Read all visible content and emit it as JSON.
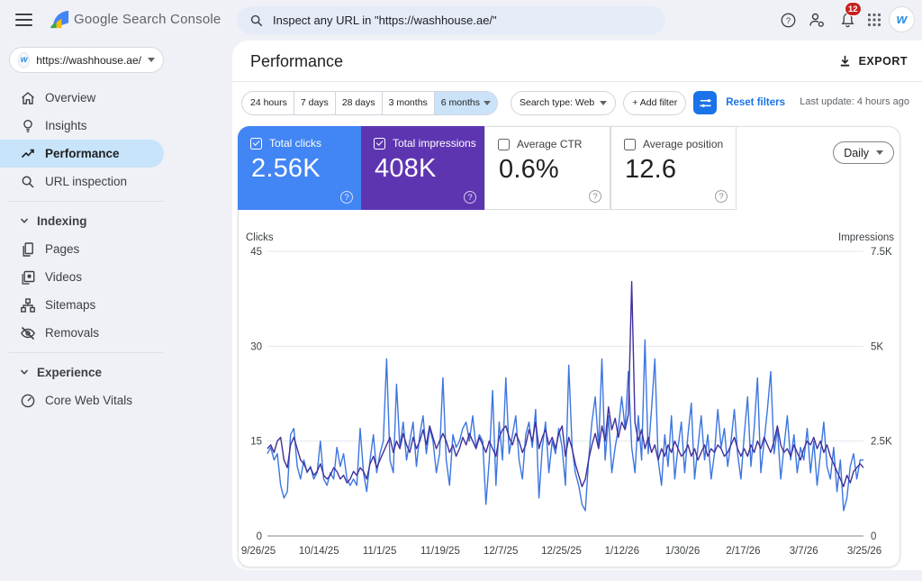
{
  "topbar": {
    "product_name": "Google Search Console",
    "search_placeholder": "Inspect any URL in \"https://washhouse.ae/\"",
    "notification_count": "12",
    "avatar_letter": "w"
  },
  "sidebar": {
    "property_url": "https://washhouse.ae/",
    "property_favicon_letter": "w",
    "items": [
      {
        "type": "link",
        "icon": "home-icon",
        "label": "Overview",
        "selected": false
      },
      {
        "type": "link",
        "icon": "insights-icon",
        "label": "Insights",
        "selected": false
      },
      {
        "type": "link",
        "icon": "performance-icon",
        "label": "Performance",
        "selected": true
      },
      {
        "type": "link",
        "icon": "search-icon",
        "label": "URL inspection",
        "selected": false
      },
      {
        "type": "divider"
      },
      {
        "type": "section",
        "label": "Indexing"
      },
      {
        "type": "link",
        "icon": "pages-icon",
        "label": "Pages",
        "selected": false
      },
      {
        "type": "link",
        "icon": "videos-icon",
        "label": "Videos",
        "selected": false
      },
      {
        "type": "link",
        "icon": "sitemaps-icon",
        "label": "Sitemaps",
        "selected": false
      },
      {
        "type": "link",
        "icon": "removals-icon",
        "label": "Removals",
        "selected": false
      },
      {
        "type": "divider"
      },
      {
        "type": "section",
        "label": "Experience"
      },
      {
        "type": "link",
        "icon": "core-web-vitals-icon",
        "label": "Core Web Vitals",
        "selected": false
      }
    ]
  },
  "header": {
    "title": "Performance",
    "export_label": "EXPORT"
  },
  "filters": {
    "ranges": [
      "24 hours",
      "7 days",
      "28 days",
      "3 months",
      "6 months"
    ],
    "selected_range": "6 months",
    "search_type": "Search type: Web",
    "add_filter": "+ Add filter",
    "reset": "Reset filters",
    "last_update": "Last update: 4 hours ago"
  },
  "interval": {
    "label": "Daily"
  },
  "cards": [
    {
      "label": "Total clicks",
      "value": "2.56K",
      "checked": true,
      "color": "#4285f4"
    },
    {
      "label": "Total impressions",
      "value": "408K",
      "checked": true,
      "color": "#5e35b1"
    },
    {
      "label": "Average CTR",
      "value": "0.6%",
      "checked": false,
      "color": "#ffffff"
    },
    {
      "label": "Average position",
      "value": "12.6",
      "checked": false,
      "color": "#ffffff"
    }
  ],
  "chart_data": {
    "type": "line",
    "left_axis": {
      "label": "Clicks",
      "ticks": [
        "45",
        "30",
        "15",
        "0"
      ],
      "max": 45
    },
    "right_axis": {
      "label": "Impressions",
      "ticks": [
        "7.5K",
        "5K",
        "2.5K",
        "0"
      ],
      "max": 7500
    },
    "x_tick_labels": [
      "9/26/25",
      "10/14/25",
      "11/1/25",
      "11/19/25",
      "12/7/25",
      "12/25/25",
      "1/12/26",
      "1/30/26",
      "2/17/26",
      "3/7/26",
      "3/25/26"
    ],
    "series": [
      {
        "name": "Clicks",
        "color": "#3d76e0",
        "axis": "left",
        "values": [
          13,
          14,
          12,
          13,
          8,
          6,
          7,
          16,
          17,
          11,
          9,
          12,
          10,
          11,
          9,
          10,
          15,
          9,
          8,
          10,
          9,
          14,
          11,
          13,
          9,
          8,
          9,
          8,
          17,
          10,
          7,
          12,
          16,
          10,
          13,
          15,
          28,
          12,
          10,
          24,
          14,
          18,
          12,
          15,
          18,
          11,
          16,
          19,
          13,
          17,
          15,
          10,
          13,
          25,
          12,
          8,
          16,
          14,
          15,
          17,
          18,
          15,
          19,
          14,
          16,
          15,
          5,
          12,
          23,
          8,
          18,
          12,
          25,
          13,
          16,
          19,
          12,
          9,
          16,
          18,
          14,
          20,
          6,
          14,
          18,
          10,
          15,
          13,
          17,
          14,
          8,
          27,
          14,
          10,
          8,
          5,
          4,
          12,
          18,
          22,
          14,
          28,
          12,
          19,
          10,
          14,
          17,
          22,
          17,
          26,
          14,
          10,
          19,
          12,
          31,
          13,
          20,
          28,
          12,
          8,
          16,
          11,
          19,
          9,
          14,
          18,
          10,
          16,
          21,
          9,
          14,
          19,
          12,
          16,
          9,
          13,
          20,
          14,
          17,
          11,
          15,
          20,
          13,
          9,
          16,
          22,
          11,
          17,
          25,
          10,
          15,
          20,
          26,
          13,
          17,
          9,
          14,
          19,
          12,
          16,
          10,
          14,
          12,
          17,
          10,
          15,
          8,
          13,
          18,
          11,
          9,
          14,
          7,
          12,
          4,
          6,
          11,
          13,
          9,
          12,
          12
        ]
      },
      {
        "name": "Impressions",
        "color": "#40309b",
        "axis": "right",
        "values": [
          2300,
          2400,
          2200,
          2500,
          2600,
          2000,
          1800,
          2400,
          2600,
          2300,
          2000,
          1900,
          1700,
          1800,
          1600,
          1700,
          1900,
          1600,
          1500,
          1600,
          1800,
          1700,
          1500,
          1600,
          1400,
          1500,
          1700,
          1600,
          1800,
          1700,
          1500,
          1900,
          2100,
          1800,
          2000,
          2200,
          2400,
          2600,
          2200,
          2500,
          2300,
          2700,
          2400,
          2200,
          2600,
          2300,
          2500,
          2800,
          2400,
          2900,
          2600,
          2300,
          2500,
          2700,
          2500,
          2200,
          2400,
          2100,
          2300,
          2600,
          2400,
          2700,
          2500,
          2300,
          2600,
          2400,
          2200,
          2500,
          2300,
          2100,
          2600,
          2800,
          2900,
          2600,
          2400,
          2700,
          2500,
          2200,
          2400,
          2800,
          2500,
          3000,
          2300,
          2600,
          2800,
          2400,
          2600,
          2300,
          2700,
          2900,
          2100,
          2600,
          2300,
          1900,
          1600,
          1300,
          1500,
          2000,
          2400,
          2700,
          2300,
          2900,
          2500,
          3400,
          2800,
          3100,
          2600,
          3000,
          2800,
          3200,
          6700,
          3000,
          2500,
          2800,
          2300,
          2600,
          2200,
          2400,
          2000,
          2300,
          2100,
          2400,
          2200,
          2500,
          2300,
          2100,
          2200,
          2400,
          2100,
          2300,
          2000,
          2200,
          2400,
          2100,
          2300,
          2200,
          2400,
          2300,
          2100,
          2200,
          2400,
          2600,
          2300,
          2100,
          2300,
          2100,
          2400,
          2200,
          2500,
          2300,
          2600,
          2400,
          2200,
          2500,
          2900,
          2400,
          2200,
          2300,
          2100,
          2400,
          2200,
          2000,
          2300,
          2500,
          2400,
          2600,
          2300,
          2500,
          2200,
          2400,
          2100,
          1900,
          1700,
          1500,
          1300,
          1600,
          1400,
          1700,
          1800,
          1900,
          1800
        ]
      }
    ]
  }
}
